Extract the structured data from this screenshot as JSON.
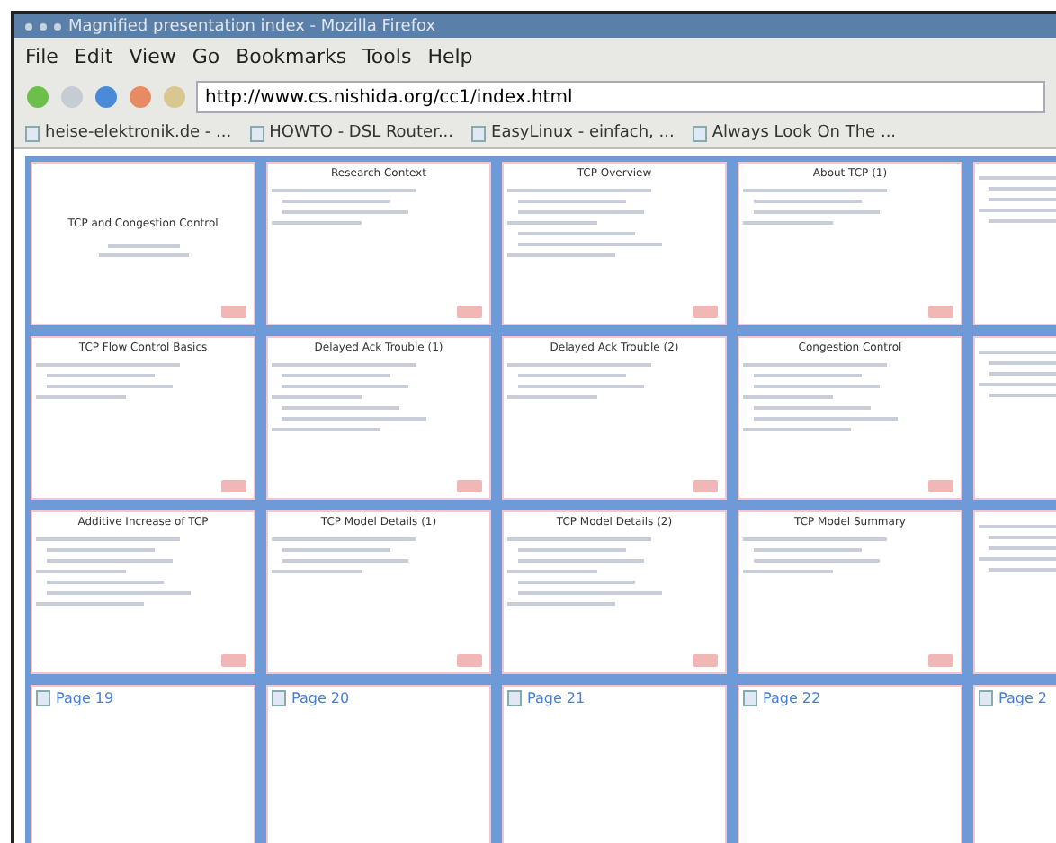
{
  "window": {
    "title": "Magnified presentation index - Mozilla Firefox"
  },
  "menu": [
    "File",
    "Edit",
    "View",
    "Go",
    "Bookmarks",
    "Tools",
    "Help"
  ],
  "address": {
    "value": "http://www.cs.nishida.org/cc1/index.html"
  },
  "bookmarks": [
    "heise-elektronik.de - ...",
    "HOWTO - DSL Router...",
    "EasyLinux - einfach, ...",
    "Always Look On The ..."
  ],
  "grid": [
    [
      {
        "kind": "title-slide",
        "title": "TCP and Congestion Control"
      },
      {
        "kind": "slide",
        "title": "Research Context"
      },
      {
        "kind": "slide",
        "title": "TCP Overview"
      },
      {
        "kind": "slide",
        "title": "About TCP (1)"
      },
      {
        "kind": "cut"
      }
    ],
    [
      {
        "kind": "slide",
        "title": "TCP Flow Control Basics"
      },
      {
        "kind": "slide",
        "title": "Delayed Ack Trouble (1)"
      },
      {
        "kind": "slide",
        "title": "Delayed Ack Trouble (2)"
      },
      {
        "kind": "slide",
        "title": "Congestion Control"
      },
      {
        "kind": "cut"
      }
    ],
    [
      {
        "kind": "slide",
        "title": "Additive Increase of TCP"
      },
      {
        "kind": "slide",
        "title": "TCP Model Details (1)"
      },
      {
        "kind": "slide",
        "title": "TCP Model Details (2)"
      },
      {
        "kind": "slide",
        "title": "TCP Model Summary"
      },
      {
        "kind": "cut"
      }
    ],
    [
      {
        "kind": "link",
        "title": "Page 19"
      },
      {
        "kind": "link",
        "title": "Page 20"
      },
      {
        "kind": "link",
        "title": "Page 21"
      },
      {
        "kind": "link",
        "title": "Page 22"
      },
      {
        "kind": "link",
        "title": "Page 2"
      }
    ]
  ]
}
